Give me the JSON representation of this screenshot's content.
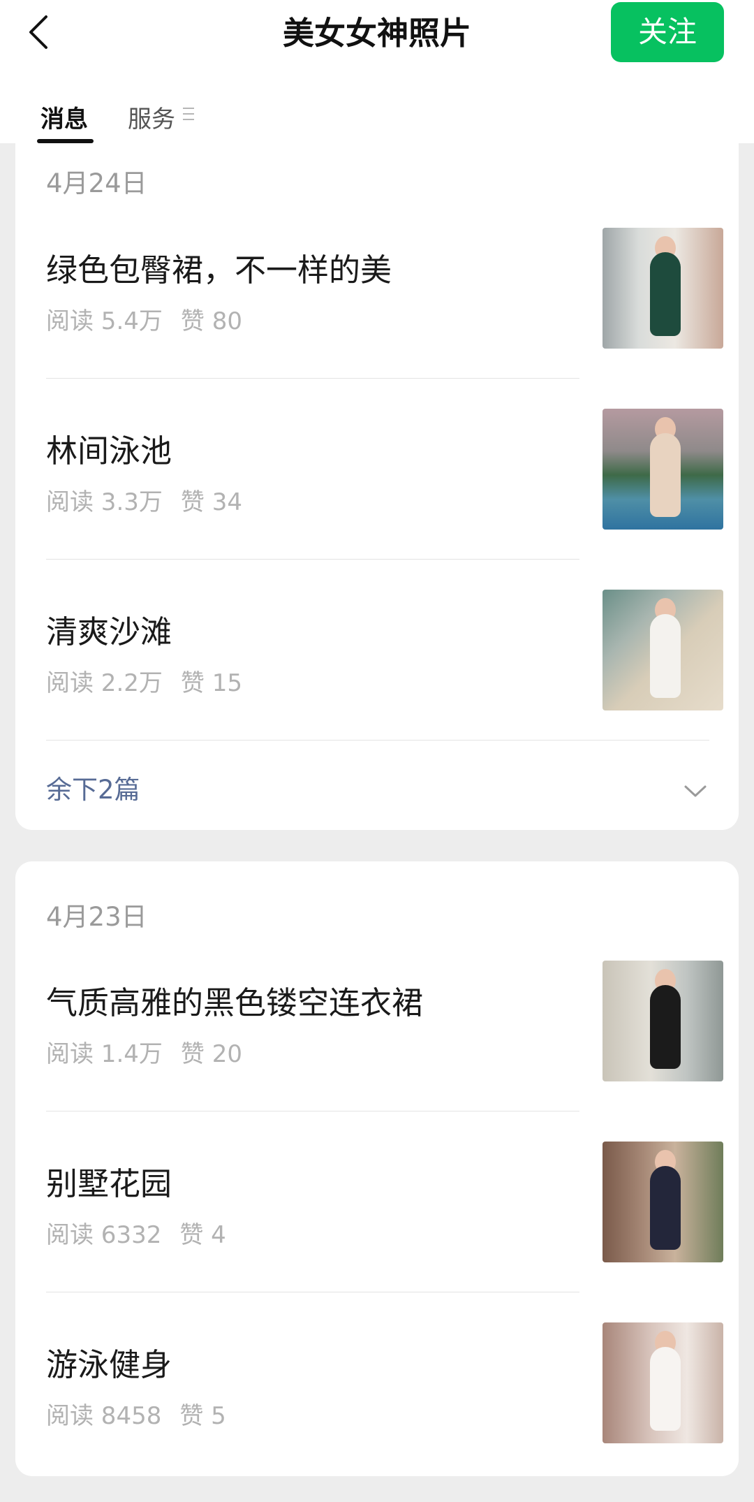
{
  "header": {
    "title": "美女女神照片",
    "follow_label": "关注",
    "back_icon": "chevron-left-icon",
    "follow_color": "#07c160"
  },
  "tabs": [
    {
      "label": "消息",
      "active": true
    },
    {
      "label": "服务",
      "active": false,
      "icon": "menu-lines-icon"
    }
  ],
  "groups": [
    {
      "date": "4月24日",
      "articles": [
        {
          "title": "绿色包臀裙，不一样的美",
          "reads": "阅读 5.4万",
          "likes": "赞 80"
        },
        {
          "title": "林间泳池",
          "reads": "阅读 3.3万",
          "likes": "赞 34"
        },
        {
          "title": "清爽沙滩",
          "reads": "阅读 2.2万",
          "likes": "赞 15"
        }
      ],
      "more_label": "余下2篇",
      "more_icon": "chevron-down-icon"
    },
    {
      "date": "4月23日",
      "articles": [
        {
          "title": "气质高雅的黑色镂空连衣裙",
          "reads": "阅读 1.4万",
          "likes": "赞 20"
        },
        {
          "title": "别墅花园",
          "reads": "阅读 6332",
          "likes": "赞 4"
        },
        {
          "title": "游泳健身",
          "reads": "阅读 8458",
          "likes": "赞 5"
        }
      ]
    }
  ],
  "colors": {
    "link": "#576b95",
    "meta": "#b2b2b2",
    "date": "#9a9a9a",
    "background": "#ededed"
  }
}
